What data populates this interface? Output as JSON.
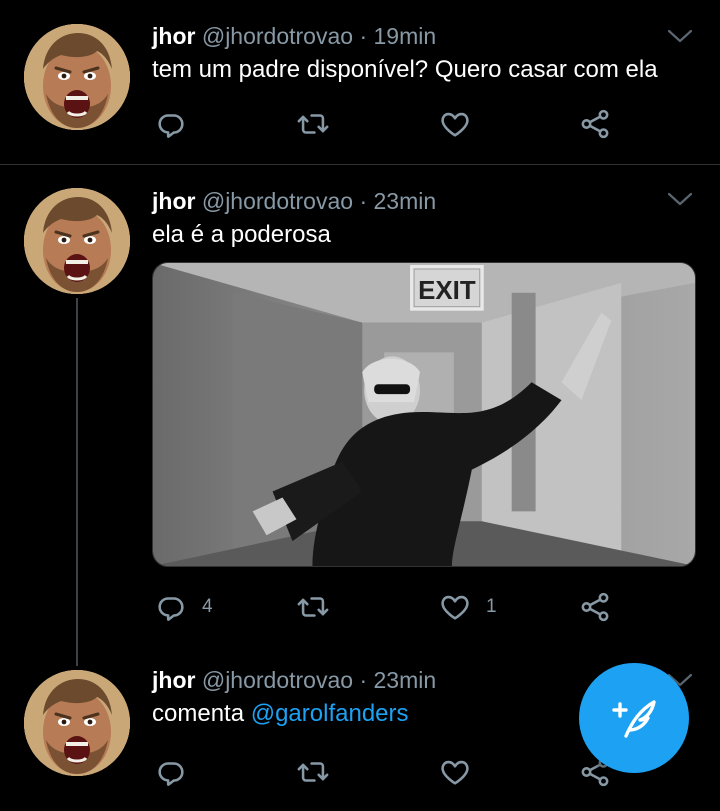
{
  "tweets": [
    {
      "name": "jhor",
      "handle": "@jhordotrovao",
      "separator": "·",
      "time": "19min",
      "text": "tem um padre disponível? Quero casar com ela",
      "replies": "",
      "likes": ""
    },
    {
      "name": "jhor",
      "handle": "@jhordotrovao",
      "separator": "·",
      "time": "23min",
      "text": "ela é a poderosa",
      "media_sign": "EXIT",
      "replies": "4",
      "likes": "1"
    },
    {
      "name": "jhor",
      "handle": "@jhordotrovao",
      "separator": "·",
      "time": "23min",
      "text_prefix": "comenta ",
      "mention": "@garolfanders"
    }
  ],
  "colors": {
    "background": "#000000",
    "accent": "#1da1f2",
    "muted": "#8899a6"
  },
  "icons": [
    "reply-icon",
    "retweet-icon",
    "like-icon",
    "share-icon",
    "chevron-down-icon",
    "compose-tweet-icon"
  ]
}
